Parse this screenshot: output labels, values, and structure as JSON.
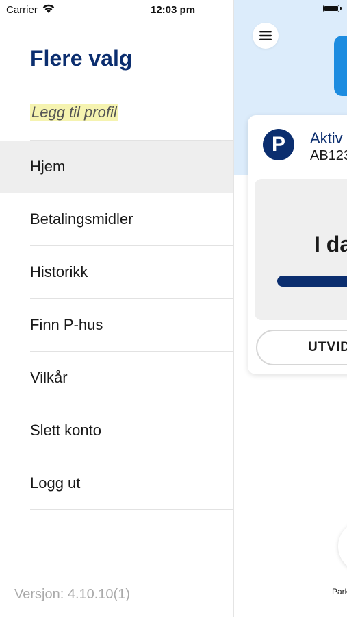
{
  "status_bar": {
    "carrier": "Carrier",
    "time": "12:03 pm"
  },
  "drawer": {
    "title": "Flere valg",
    "add_profile": "Legg til profil",
    "items": [
      {
        "label": "Hjem",
        "active": true
      },
      {
        "label": "Betalingsmidler",
        "active": false
      },
      {
        "label": "Historikk",
        "active": false
      },
      {
        "label": "Finn P-hus",
        "active": false
      },
      {
        "label": "Vilkår",
        "active": false
      },
      {
        "label": "Slett konto",
        "active": false
      },
      {
        "label": "Logg ut",
        "active": false
      }
    ],
    "version": "Versjon: 4.10.10(1)"
  },
  "background_screen": {
    "parking_badge": "P",
    "card_title": "Aktiv",
    "card_plate": "AB123",
    "card_headline": "I da",
    "expand_button": "UTVID",
    "fab_label": "Park"
  },
  "colors": {
    "brand_navy": "#0b2e6f",
    "header_light_blue": "#dcecfb",
    "accent_blue": "#1d8ce0",
    "highlight_yellow": "#f5f3b0"
  },
  "icons": {
    "menu": "hamburger-menu-icon",
    "wifi": "wifi-icon",
    "battery": "battery-icon"
  }
}
